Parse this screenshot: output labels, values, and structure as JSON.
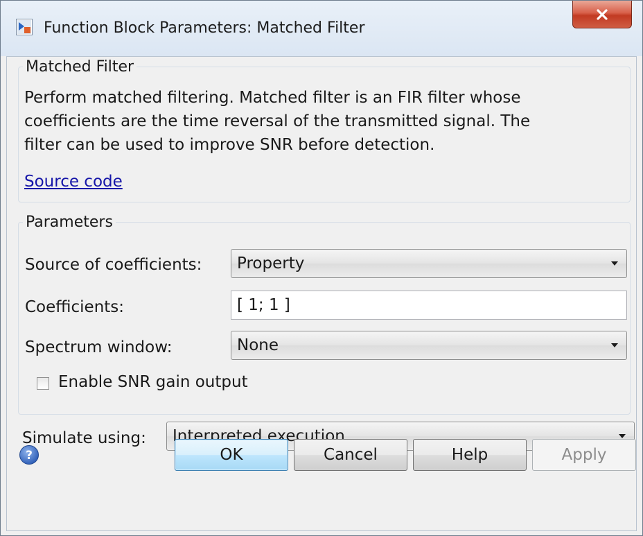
{
  "window": {
    "title": "Function Block Parameters: Matched Filter",
    "close_label": "X"
  },
  "description": {
    "legend": "Matched Filter",
    "lines": [
      "Perform matched filtering. Matched filter is an FIR filter whose",
      "coefficients are the time reversal of the transmitted signal. The",
      "filter can be used to improve SNR before detection."
    ],
    "source_link": "Source code"
  },
  "parameters": {
    "legend": "Parameters",
    "source_of_coefficients": {
      "label": "Source of coefficients:",
      "value": "Property"
    },
    "coefficients": {
      "label": "Coefficients:",
      "value": "[ 1; 1 ]"
    },
    "spectrum_window": {
      "label": "Spectrum window:",
      "value": "None"
    },
    "snr_gain_output": {
      "label": "Enable SNR gain output",
      "checked": false
    }
  },
  "simulate": {
    "label": "Simulate using:",
    "value": "Interpreted execution"
  },
  "buttons": {
    "ok": "OK",
    "cancel": "Cancel",
    "help": "Help",
    "apply": "Apply"
  },
  "icons": {
    "title": "simulink-block-icon",
    "help": "question-mark-icon"
  },
  "colors": {
    "title_bar": "#dbe6f3",
    "close_button": "#c94a33",
    "link": "#1515a8",
    "default_button_border": "#3c7fb1"
  }
}
